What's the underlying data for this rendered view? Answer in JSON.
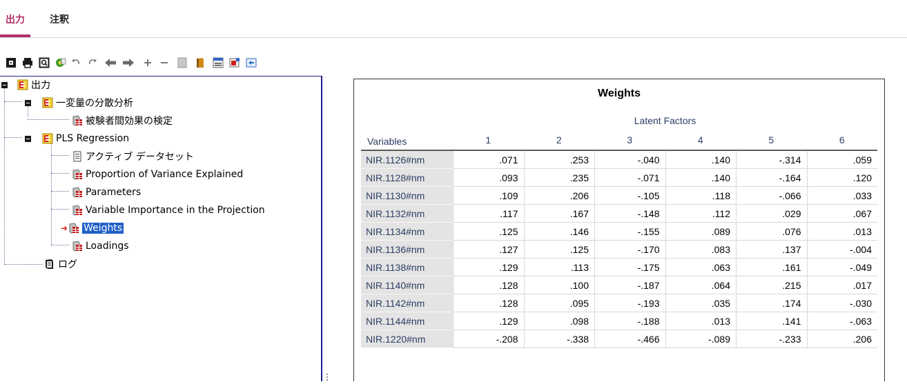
{
  "tabs": [
    {
      "label": "出力",
      "active": true
    },
    {
      "label": "注釈",
      "active": false
    }
  ],
  "toolbar": {
    "icons": [
      "save-icon",
      "print-icon",
      "print-preview-icon",
      "export-icon",
      "undo-icon",
      "redo-icon",
      "go-back-icon",
      "go-forward-icon",
      "expand-icon",
      "collapse-icon",
      "show-icon",
      "hide-icon",
      "insert-heading-icon",
      "insert-title-icon",
      "insert-text-icon"
    ]
  },
  "tree": {
    "root": "出力",
    "oneway": "一変量の分散分析",
    "oneway_child": "被験者間効果の検定",
    "pls": "PLS Regression",
    "pls_children": [
      "アクティブ データセット",
      "Proportion of Variance Explained",
      "Parameters",
      "Variable Importance in the Projection",
      "Weights",
      "Loadings"
    ],
    "log": "ログ",
    "selected_item": "Weights"
  },
  "table": {
    "title": "Weights",
    "super_header": "Latent Factors",
    "row_header_label": "Variables",
    "columns": [
      "1",
      "2",
      "3",
      "4",
      "5",
      "6"
    ],
    "rows": [
      {
        "label": "NIR.1126#nm",
        "values": [
          ".071",
          ".253",
          "-.040",
          ".140",
          "-.314",
          ".059"
        ]
      },
      {
        "label": "NIR.1128#nm",
        "values": [
          ".093",
          ".235",
          "-.071",
          ".140",
          "-.164",
          ".120"
        ]
      },
      {
        "label": "NIR.1130#nm",
        "values": [
          ".109",
          ".206",
          "-.105",
          ".118",
          "-.066",
          ".033"
        ]
      },
      {
        "label": "NIR.1132#nm",
        "values": [
          ".117",
          ".167",
          "-.148",
          ".112",
          ".029",
          ".067"
        ]
      },
      {
        "label": "NIR.1134#nm",
        "values": [
          ".125",
          ".146",
          "-.155",
          ".089",
          ".076",
          ".013"
        ]
      },
      {
        "label": "NIR.1136#nm",
        "values": [
          ".127",
          ".125",
          "-.170",
          ".083",
          ".137",
          "-.004"
        ]
      },
      {
        "label": "NIR.1138#nm",
        "values": [
          ".129",
          ".113",
          "-.175",
          ".063",
          ".161",
          "-.049"
        ]
      },
      {
        "label": "NIR.1140#nm",
        "values": [
          ".128",
          ".100",
          "-.187",
          ".064",
          ".215",
          ".017"
        ]
      },
      {
        "label": "NIR.1142#nm",
        "values": [
          ".128",
          ".095",
          "-.193",
          ".035",
          ".174",
          "-.030"
        ]
      },
      {
        "label": "NIR.1144#nm",
        "values": [
          ".129",
          ".098",
          "-.188",
          ".013",
          ".141",
          "-.063"
        ]
      },
      {
        "label": "NIR.1220#nm",
        "values": [
          "-.208",
          "-.338",
          "-.466",
          "-.089",
          "-.233",
          ".206"
        ]
      }
    ]
  },
  "colors": {
    "accent": "#b0316a",
    "selection": "#1f5fc7",
    "header_text": "#2b3d63",
    "row_label_bg": "#e4e4e4"
  }
}
